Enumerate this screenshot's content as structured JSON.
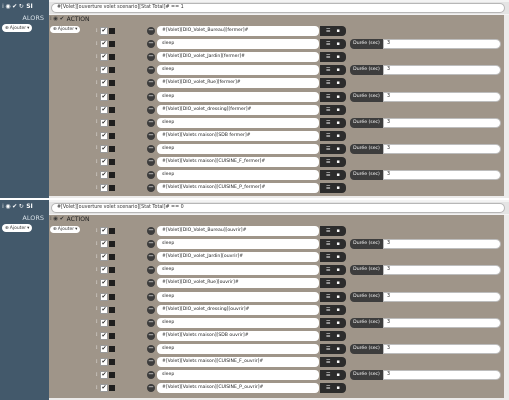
{
  "icons": {
    "grip": "grip-icon",
    "eye": "eye-icon",
    "check": "check-icon",
    "refresh": "refresh-icon",
    "minus": "minus-circle-icon",
    "list": "list-icon",
    "trash": "trash-icon",
    "caret": "caret-down-icon"
  },
  "blocks": [
    {
      "si_label": "SI",
      "condition": "#[Volet][ouverture volet scenario][Stat Total]# == 1",
      "alors_label": "ALORS",
      "add_label": "Ajouter",
      "action_label": "ACTION",
      "action_add_label": "Ajouter",
      "rows": [
        {
          "text": "#[Volet][DIO_Volet_Bureau][fermer]#"
        },
        {
          "text": "sleep",
          "duration_label": "Durée (sec)",
          "duration_value": "3"
        },
        {
          "text": "#[Volet][DIO_volet_Jardin][fermer]#"
        },
        {
          "text": "sleep",
          "duration_label": "Durée (sec)",
          "duration_value": "3"
        },
        {
          "text": "#[Volet][DIO_volet_Rue][fermer]#"
        },
        {
          "text": "sleep",
          "duration_label": "Durée (sec)",
          "duration_value": "3"
        },
        {
          "text": "#[Volet][DIO_volet_dressing][fermer]#"
        },
        {
          "text": "sleep",
          "duration_label": "Durée (sec)",
          "duration_value": "3"
        },
        {
          "text": "#[Volet][Volets maison][SDB fermer]#"
        },
        {
          "text": "sleep",
          "duration_label": "Durée (sec)",
          "duration_value": "3"
        },
        {
          "text": "#[Volet][Volets maison][CUISINE_F_fermer]#"
        },
        {
          "text": "sleep",
          "duration_label": "Durée (sec)",
          "duration_value": "3"
        },
        {
          "text": "#[Volet][Volets maison][CUISINE_P_fermer]#"
        }
      ]
    },
    {
      "si_label": "SI",
      "condition": "#[Volet][ouverture volet scenario][Stat Total]# == 0",
      "alors_label": "ALORS",
      "add_label": "Ajouter",
      "action_label": "ACTION",
      "action_add_label": "Ajouter",
      "rows": [
        {
          "text": "#[Volet][DIO_Volet_Bureau][ouvrir]#"
        },
        {
          "text": "sleep",
          "duration_label": "Durée (sec)",
          "duration_value": "3"
        },
        {
          "text": "#[Volet][DIO_volet_Jardin][ouvrir]#"
        },
        {
          "text": "sleep",
          "duration_label": "Durée (sec)",
          "duration_value": "3"
        },
        {
          "text": "#[Volet][DIO_volet_Rue][ouvrir]#"
        },
        {
          "text": "sleep",
          "duration_label": "Durée (sec)",
          "duration_value": "3"
        },
        {
          "text": "#[Volet][DIO_volet_dressing][ouvrir]#"
        },
        {
          "text": "sleep",
          "duration_label": "Durée (sec)",
          "duration_value": "3"
        },
        {
          "text": "#[Volet][Volets maison][SDB ouvrir]#"
        },
        {
          "text": "sleep",
          "duration_label": "Durée (sec)",
          "duration_value": "3"
        },
        {
          "text": "#[Volet][Volets maison][CUISINE_F_ouvrir]#"
        },
        {
          "text": "sleep",
          "duration_label": "Durée (sec)",
          "duration_value": "3"
        },
        {
          "text": "#[Volet][Volets maison][CUISINE_P_ouvrir]#"
        }
      ]
    }
  ]
}
